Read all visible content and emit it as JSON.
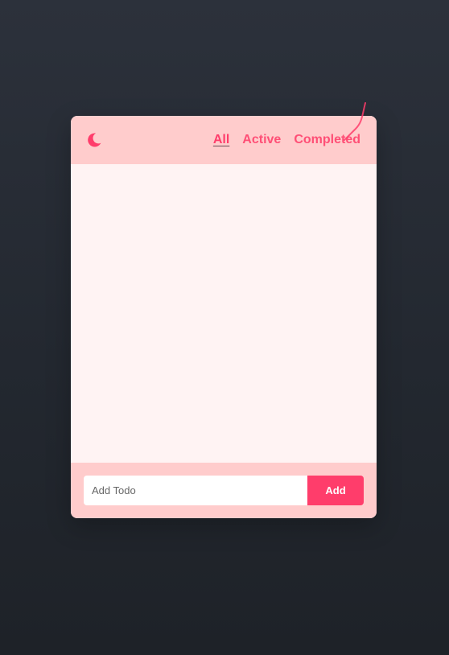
{
  "header": {
    "theme_icon": "moon-icon",
    "tabs": [
      {
        "label": "All",
        "active": true
      },
      {
        "label": "Active",
        "active": false
      },
      {
        "label": "Completed",
        "active": false
      }
    ]
  },
  "todo_list": {
    "items": []
  },
  "footer": {
    "input_value": "",
    "input_placeholder": "Add Todo",
    "add_label": "Add"
  },
  "colors": {
    "accent": "#ff3d6b",
    "header_bg": "#ffcccc",
    "list_bg": "#fff3f3",
    "page_bg": "#262b33"
  }
}
